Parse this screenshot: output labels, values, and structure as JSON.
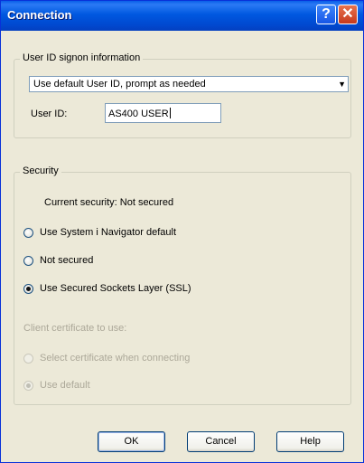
{
  "window": {
    "title": "Connection",
    "help_glyph": "?",
    "close_glyph": "✕"
  },
  "user_group": {
    "legend": "User ID signon information",
    "signon_select": {
      "value": "Use default User ID, prompt as needed",
      "arrow": "▼"
    },
    "user_id_label": "User ID:",
    "user_id_value": "AS400 USER"
  },
  "security_group": {
    "legend": "Security",
    "current_security_label": "Current security:",
    "current_security_value": "Not secured",
    "options": [
      {
        "label": "Use System i Navigator default",
        "checked": false
      },
      {
        "label": "Not secured",
        "checked": false
      },
      {
        "label": "Use Secured Sockets Layer (SSL)",
        "checked": true
      }
    ],
    "cert_label": "Client certificate to use:",
    "cert_options": [
      {
        "label": "Select certificate when connecting",
        "checked": false
      },
      {
        "label": "Use default",
        "checked": true
      }
    ]
  },
  "buttons": {
    "ok": "OK",
    "cancel": "Cancel",
    "help": "Help"
  },
  "colors": {
    "titlebar": "#0058e0",
    "dialog_bg": "#ece9d8",
    "disabled_text": "#aca899"
  }
}
